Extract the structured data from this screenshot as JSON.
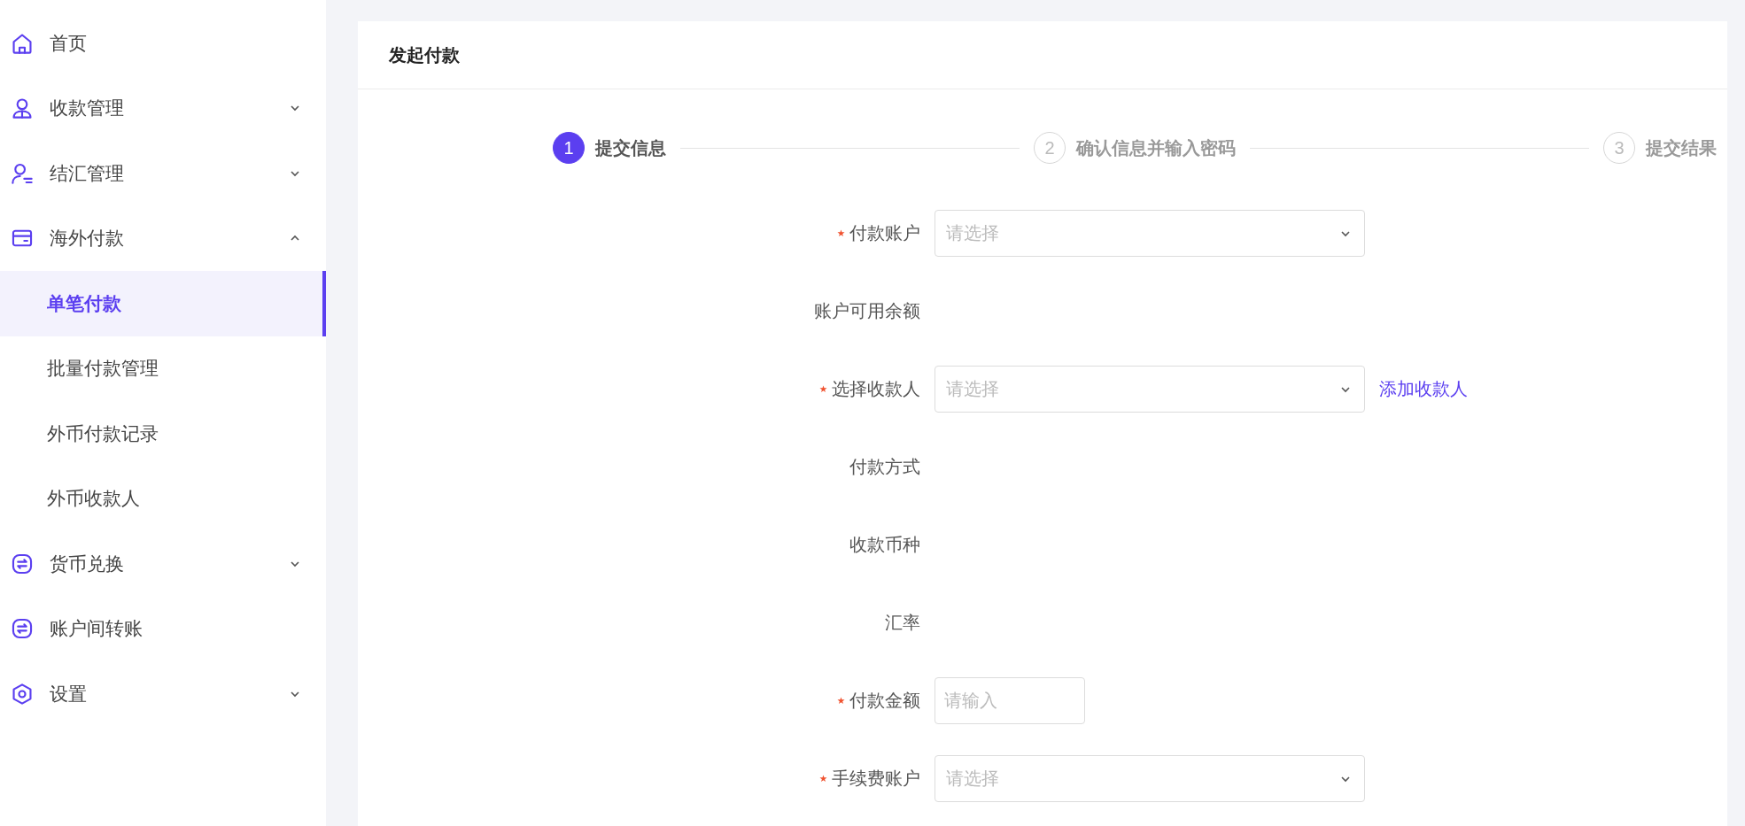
{
  "sidebar": {
    "items": [
      {
        "label": "首页",
        "selected": false
      },
      {
        "label": "收款管理",
        "selected": false,
        "expanded": false
      },
      {
        "label": "结汇管理",
        "selected": false,
        "expanded": false
      },
      {
        "label": "海外付款",
        "selected": false,
        "expanded": true,
        "children": [
          {
            "label": "单笔付款",
            "selected": true
          },
          {
            "label": "批量付款管理",
            "selected": false
          },
          {
            "label": "外币付款记录",
            "selected": false
          },
          {
            "label": "外币收款人",
            "selected": false
          }
        ]
      },
      {
        "label": "货币兑换",
        "selected": false,
        "expanded": false
      },
      {
        "label": "账户间转账",
        "selected": false
      },
      {
        "label": "设置",
        "selected": false,
        "expanded": false
      }
    ]
  },
  "page": {
    "title": "发起付款",
    "steps": [
      {
        "number": "1",
        "label": "提交信息",
        "selected": true
      },
      {
        "number": "2",
        "label": "确认信息并输入密码",
        "selected": false
      },
      {
        "number": "3",
        "label": "提交结果",
        "selected": false
      }
    ],
    "fields": [
      {
        "kind": "select",
        "label": "付款账户",
        "required": true,
        "placeholder": "请选择"
      },
      {
        "kind": "text",
        "label": "账户可用余额",
        "required": false
      },
      {
        "kind": "select",
        "label": "选择收款人",
        "required": true,
        "placeholder": "请选择",
        "link": "添加收款人"
      },
      {
        "kind": "text",
        "label": "付款方式",
        "required": false
      },
      {
        "kind": "text",
        "label": "收款币种",
        "required": false
      },
      {
        "kind": "text",
        "label": "汇率",
        "required": false
      },
      {
        "kind": "input",
        "label": "付款金额",
        "required": true,
        "placeholder": "请输入"
      },
      {
        "kind": "select",
        "label": "手续费账户",
        "required": true,
        "placeholder": "请选择"
      }
    ]
  }
}
